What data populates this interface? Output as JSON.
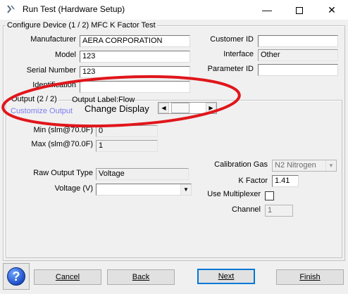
{
  "window": {
    "title": "Run Test (Hardware Setup)",
    "icon": "test-icon",
    "controls": [
      "minimize-icon",
      "maximize-icon",
      "close-icon"
    ]
  },
  "device": {
    "group_title": "Configure Device (1 / 2) MFC K Factor Test",
    "manufacturer_label": "Manufacturer",
    "manufacturer_value": "AERA CORPORATION",
    "model_label": "Model",
    "model_value": "123",
    "serial_label": "Serial Number",
    "serial_value": "123",
    "identification_label": "Identification",
    "identification_value": "",
    "customer_id_label": "Customer ID",
    "customer_id_value": "",
    "interface_label": "Interface",
    "interface_value": "Other",
    "parameter_id_label": "Parameter ID",
    "parameter_id_value": ""
  },
  "output": {
    "group_title": "Output (2 / 2)",
    "output_label": "Output Label:Flow",
    "customize_link": "Customize Output",
    "change_display_label": "Change Display",
    "min_label": "Min (slm@70.0F)",
    "min_value": "0",
    "max_label": "Max (slm@70.0F)",
    "max_value": "1",
    "raw_output_type_label": "Raw Output Type",
    "raw_output_type_value": "Voltage",
    "voltage_label": "Voltage (V)",
    "voltage_value": "",
    "calibration_gas_label": "Calibration Gas",
    "calibration_gas_value": "N2 Nitrogen",
    "k_factor_label": "K Factor",
    "k_factor_value": "1.41",
    "use_multiplexer_label": "Use Multiplexer",
    "channel_label": "Channel",
    "channel_value": "1"
  },
  "buttons": {
    "help_glyph": "?",
    "cancel": "Cancel",
    "back": "Back",
    "next": "Next",
    "finish": "Finish"
  },
  "colors": {
    "link": "#7c7cf0",
    "annotation": "#e0161b",
    "default_button_border": "#0078d7"
  }
}
